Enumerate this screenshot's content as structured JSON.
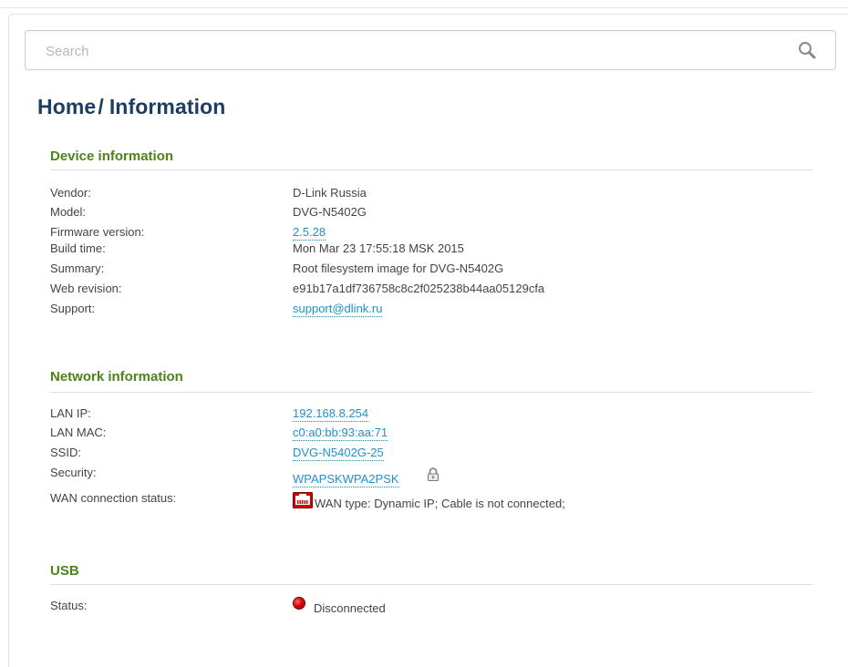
{
  "search": {
    "placeholder": "Search",
    "icon": "search-icon"
  },
  "breadcrumb": {
    "home": "Home",
    "separator": "/",
    "current": "Information"
  },
  "device_info": {
    "title": "Device information",
    "rows": [
      {
        "label": "Vendor:",
        "value": "D-Link Russia"
      },
      {
        "label": "Model:",
        "value": "DVG-N5402G"
      },
      {
        "label": "Firmware version:",
        "value": "2.5.28"
      },
      {
        "label": "Build time:",
        "value": "Mon Mar 23 17:55:18 MSK 2015"
      },
      {
        "label": "Summary:",
        "value": "Root filesystem image for DVG-N5402G"
      },
      {
        "label": "Web revision:",
        "value": "e91b17a1df736758c8c2f025238b44aa05129cfa"
      },
      {
        "label": "Support:",
        "value": "support@dlink.ru"
      }
    ]
  },
  "network_info": {
    "title": "Network information",
    "rows": [
      {
        "label": "LAN IP:",
        "value": "192.168.8.254"
      },
      {
        "label": "LAN MAC:",
        "value": "c0:a0:bb:93:aa:71"
      },
      {
        "label": "SSID:",
        "value": "DVG-N5402G-25"
      },
      {
        "label": "Security:",
        "value": "WPAPSKWPA2PSK"
      },
      {
        "label": "WAN connection status:",
        "value": "WAN type: Dynamic IP; Cable is not connected;"
      }
    ]
  },
  "usb": {
    "title": "USB",
    "rows": [
      {
        "label": "Status:",
        "value": "Disconnected"
      }
    ]
  },
  "colors": {
    "title": "#1d3d64",
    "section_title": "#4a8616",
    "link": "#1e90d6",
    "status_disconnected": "#e00000",
    "wan_icon": "#cc0000"
  }
}
